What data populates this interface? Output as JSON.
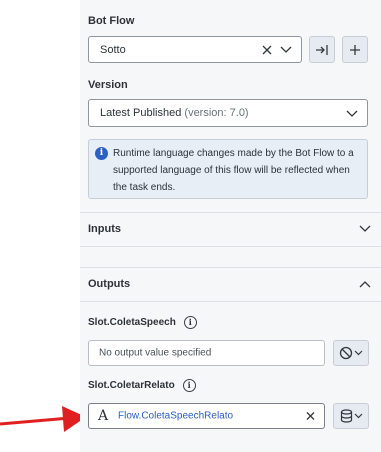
{
  "bot_flow": {
    "label": "Bot Flow",
    "selected": "Sotto",
    "open_icon": "open-flow-icon",
    "add_icon": "plus-icon"
  },
  "version": {
    "label": "Version",
    "selected_main": "Latest Published",
    "selected_detail": "(version: 7.0)"
  },
  "info": {
    "text": "Runtime language changes made by the Bot Flow to a supported language of this flow will be reflected when the task ends."
  },
  "inputs": {
    "title": "Inputs",
    "expanded": false
  },
  "outputs": {
    "title": "Outputs",
    "expanded": true,
    "slots": [
      {
        "name": "Slot.ColetaSpeech",
        "value": "No output value specified",
        "mode_icon": "no-value-icon"
      },
      {
        "name": "Slot.ColetarRelato",
        "value": "Flow.ColetaSpeechRelato",
        "type_icon": "string-variable-icon",
        "mode_icon": "database-icon"
      }
    ]
  },
  "colors": {
    "accent": "#2a60c4",
    "arrow": "#e02020",
    "panel_bg": "#f6f7f9"
  }
}
